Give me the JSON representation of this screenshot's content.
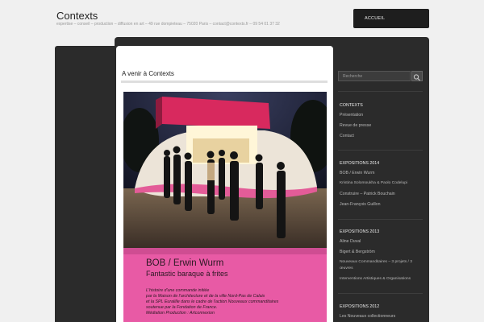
{
  "site": {
    "title": "Contexts",
    "tagline": "expertise – conseil – production – diffusion en art – 49 rue dompieteau – 75020 Paris – contact@contexts.fr – 09 54 01 37 32"
  },
  "nav": {
    "home": "ACCUEIL"
  },
  "post": {
    "title": "A venir à Contexts",
    "poster": {
      "headline": "BOB / Erwin Wurm",
      "subtitle": "Fantastic baraque à frites",
      "lines": [
        "L'histoire d'une commande initiée",
        "par la Maison de l'architecture et de la ville Nord-Pas de Calais",
        "et la SPL Euralille dans le cadre de l'action Nouveaux commanditaires",
        "soutenue par la Fondation de France.",
        "Médiation Production : Artconnexion"
      ]
    }
  },
  "sidebar": {
    "search_placeholder": "Recherche",
    "contexts": {
      "heading": "CONTEXTS",
      "links": [
        "Présentation",
        "Revue de presse",
        "Contact"
      ]
    },
    "expo2014": {
      "heading": "EXPOSITIONS 2014",
      "links": [
        "BOB / Erwin Wurm",
        "Kristina Solomoukha & Paolo Codelupi",
        "Construire – Patrick Bouchain",
        "Jean-François Guillon"
      ]
    },
    "expo2013": {
      "heading": "EXPOSITIONS 2013",
      "links": [
        "Aline Duval",
        "Bigert & Bergström",
        "Nouveaux Commanditaires – 3 projets / 3 œuvres",
        "Interventions Artistiques & Organisations"
      ]
    },
    "expo2012": {
      "heading": "EXPOSITIONS 2012",
      "links": [
        "Les Nouveaux collectionneurs"
      ]
    }
  }
}
